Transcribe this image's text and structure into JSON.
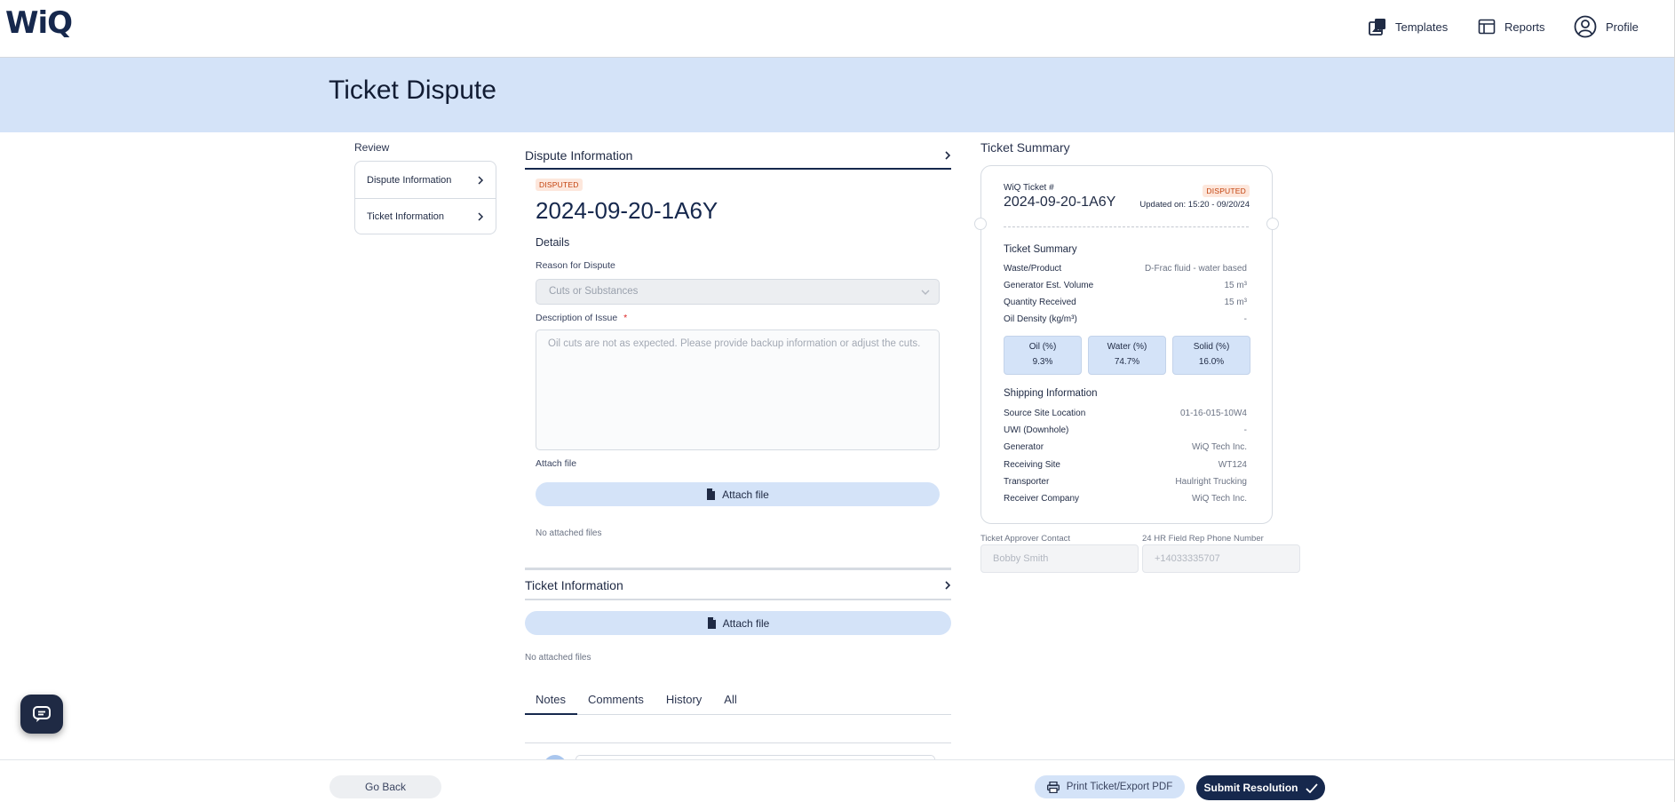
{
  "app": {
    "logo": "WiQ"
  },
  "nav": {
    "templates": "Templates",
    "reports": "Reports",
    "profile": "Profile"
  },
  "page": {
    "title": "Ticket Dispute"
  },
  "review": {
    "label": "Review",
    "items": [
      {
        "label": "Dispute Information"
      },
      {
        "label": "Ticket Information"
      }
    ]
  },
  "dispute": {
    "section_title": "Dispute Information",
    "status_badge": "DISPUTED",
    "ticket_number": "2024-09-20-1A6Y",
    "details_heading": "Details",
    "reason_label": "Reason for Dispute",
    "reason_value": "Cuts or Substances",
    "description_label": "Description of Issue",
    "required_mark": "*",
    "description_value": "Oil cuts are not as expected. Please provide backup information or adjust the cuts.",
    "attach_label": "Attach file",
    "attach_button": "Attach file",
    "no_files": "No attached files"
  },
  "ticket_info": {
    "section_title": "Ticket Information",
    "attach_button": "Attach file",
    "no_files": "No attached files"
  },
  "tabs": [
    "Notes",
    "Comments",
    "History",
    "All"
  ],
  "summary": {
    "title": "Ticket Summary",
    "ticket_label": "WiQ Ticket #",
    "status_badge": "DISPUTED",
    "ticket_number": "2024-09-20-1A6Y",
    "updated": "Updated on: 15:20 - 09/20/24",
    "summary_heading": "Ticket Summary",
    "rows": [
      {
        "label": "Waste/Product",
        "value": "D-Frac fluid - water based"
      },
      {
        "label": "Generator Est. Volume",
        "value": "15 m³"
      },
      {
        "label": "Quantity Received",
        "value": "15 m³"
      },
      {
        "label": "Oil Density (kg/m³)",
        "value": "-"
      }
    ],
    "cuts": [
      {
        "label": "Oil (%)",
        "value": "9.3%"
      },
      {
        "label": "Water (%)",
        "value": "74.7%"
      },
      {
        "label": "Solid (%)",
        "value": "16.0%"
      }
    ],
    "shipping_heading": "Shipping Information",
    "shipping": [
      {
        "label": "Source Site Location",
        "value": "01-16-015-10W4"
      },
      {
        "label": "UWI (Downhole)",
        "value": "-"
      },
      {
        "label": "Generator",
        "value": "WiQ Tech Inc."
      },
      {
        "label": "Receiving Site",
        "value": "WT124"
      },
      {
        "label": "Transporter",
        "value": "Haulright Trucking"
      },
      {
        "label": "Receiver Company",
        "value": "WiQ Tech Inc."
      }
    ]
  },
  "contacts": {
    "approver_label": "Ticket Approver Contact",
    "approver_value": "Bobby Smith",
    "phone_label": "24 HR Field Rep Phone Number",
    "phone_value": "+14033335707"
  },
  "footer": {
    "go_back": "Go Back",
    "print": "Print Ticket/Export PDF",
    "submit": "Submit Resolution"
  },
  "colors": {
    "brand": "#16284d",
    "banner": "#d4e3f8",
    "badge_text": "#c2410c",
    "badge_bg": "#fde7dc"
  }
}
